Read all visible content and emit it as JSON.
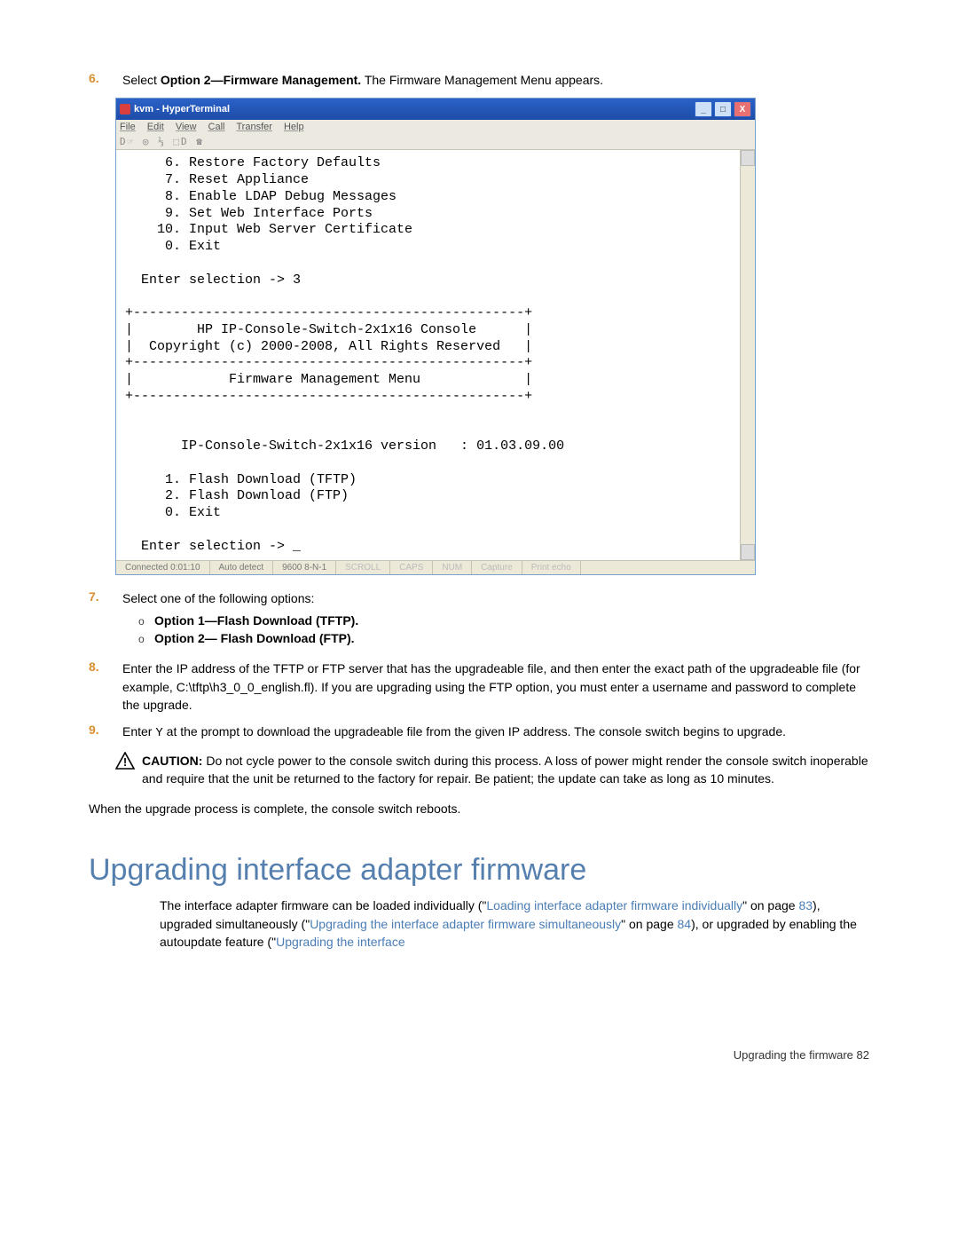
{
  "steps": {
    "s6": {
      "num": "6.",
      "text_a": "Select ",
      "bold": "Option 2—Firmware Management.",
      "text_b": " The Firmware Management Menu appears."
    },
    "s7": {
      "num": "7.",
      "intro": "Select one of the following options:",
      "opt1": "Option 1—Flash Download (TFTP).",
      "opt2": "Option 2— Flash Download (FTP)."
    },
    "s8": {
      "num": "8.",
      "text": "Enter the IP address of the TFTP or FTP server that has the upgradeable file, and then enter the exact path of the upgradeable file (for example, C:\\tftp\\h3_0_0_english.fl). If you are upgrading using the FTP option, you must enter a username and password to complete the upgrade."
    },
    "s9": {
      "num": "9.",
      "text_a": "Enter ",
      "mono": "Y",
      "text_b": " at the prompt to download the upgradeable file from the given IP address. The console switch begins to upgrade."
    }
  },
  "caution": {
    "label": "CAUTION:",
    "text": "  Do not cycle power to the console switch during this process. A loss of power might render the console switch inoperable and require that the unit be returned to the factory for repair. Be patient; the update can take as long as 10 minutes."
  },
  "after": "When the upgrade process is complete, the console switch reboots.",
  "heading": "Upgrading interface adapter firmware",
  "para": {
    "t1": "The interface adapter firmware can be loaded individually (\"",
    "l1": "Loading interface adapter firmware individually",
    "t2": "\" on page ",
    "p1": "83",
    "t3": "), upgraded simultaneously (\"",
    "l2": "Upgrading the interface adapter firmware simultaneously",
    "t4": "\" on page ",
    "p2": "84",
    "t5": "), or upgraded by enabling the autoupdate feature (\"",
    "l3": "Upgrading the interface",
    "t6": ""
  },
  "footer": {
    "text": "Upgrading the firmware   82"
  },
  "ht": {
    "title": "kvm - HyperTerminal",
    "menu": {
      "file": "File",
      "edit": "Edit",
      "view": "View",
      "call": "Call",
      "transfer": "Transfer",
      "help": "Help"
    },
    "toolbar": "D☞ ◎ ⅓ ⬚D ☎",
    "body": "     6. Restore Factory Defaults\n     7. Reset Appliance\n     8. Enable LDAP Debug Messages\n     9. Set Web Interface Ports\n    10. Input Web Server Certificate\n     0. Exit\n\n  Enter selection -> 3\n\n+-------------------------------------------------+\n|        HP IP-Console-Switch-2x1x16 Console      |\n|  Copyright (c) 2000-2008, All Rights Reserved   |\n+-------------------------------------------------+\n|            Firmware Management Menu             |\n+-------------------------------------------------+\n\n\n       IP-Console-Switch-2x1x16 version   : 01.03.09.00\n\n     1. Flash Download (TFTP)\n     2. Flash Download (FTP)\n     0. Exit\n\n  Enter selection -> _",
    "status": {
      "conn": "Connected 0:01:10",
      "auto": "Auto detect",
      "baud": "9600 8-N-1",
      "scroll": "SCROLL",
      "caps": "CAPS",
      "num": "NUM",
      "capture": "Capture",
      "echo": "Print echo"
    }
  }
}
